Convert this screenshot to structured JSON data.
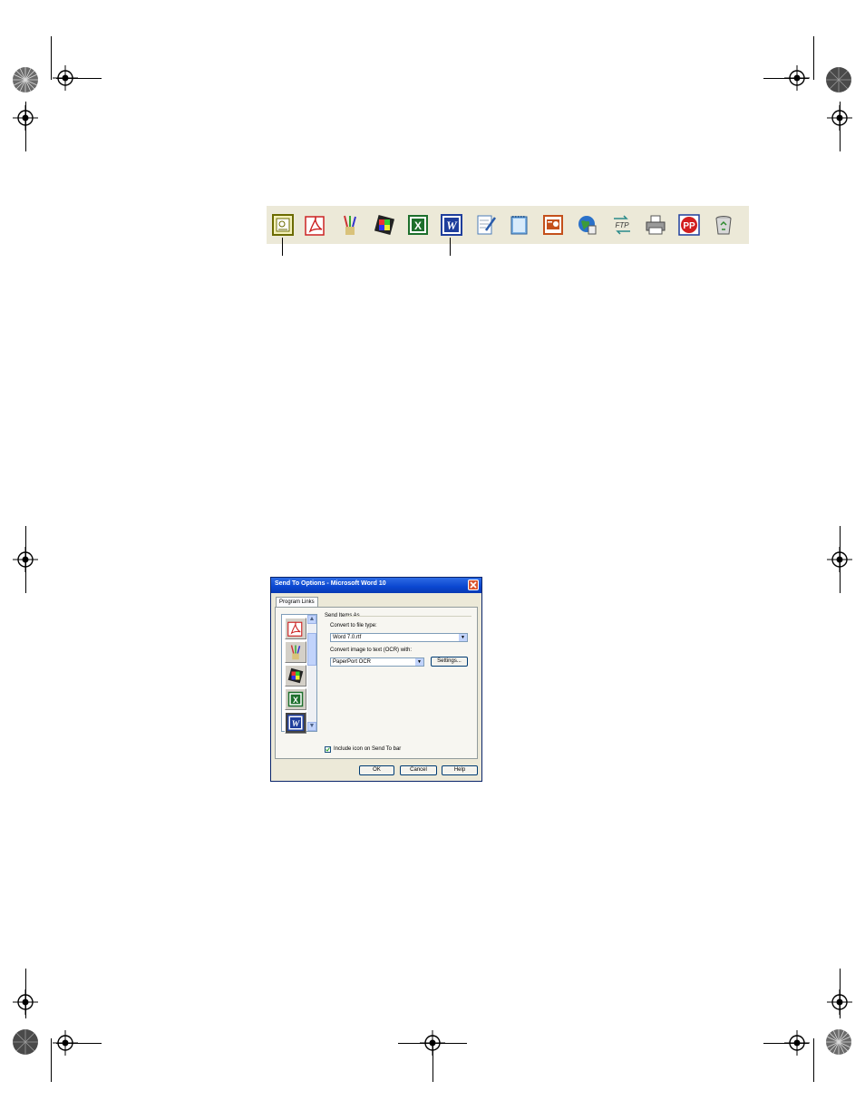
{
  "toolbar": {
    "icons": [
      "paperport-icon",
      "acrobat-pdf-icon",
      "paint-brushes-icon",
      "photo-editor-icon",
      "excel-icon",
      "word-icon",
      "wordpad-icon",
      "notepad-icon",
      "powerpoint-icon",
      "web-globe-icon",
      "ftp-icon",
      "printer-icon",
      "pagemanager-icon",
      "recycle-bin-icon"
    ]
  },
  "dialog": {
    "title": "Send To Options - Microsoft Word 10",
    "tab_label": "Program Links",
    "group_label": "Send Items As",
    "convert_label": "Convert to file type:",
    "convert_value": "Word 7.0.rtf",
    "ocr_label": "Convert image to text (OCR) with:",
    "ocr_value": "PaperPort OCR",
    "settings_button": "Settings...",
    "include_label": "Include icon on Send To bar",
    "include_checked": true,
    "ok_button": "OK",
    "cancel_button": "Cancel",
    "help_button": "Help",
    "list_icons": [
      "acrobat-pdf-icon",
      "paint-brushes-icon",
      "photo-editor-icon",
      "excel-icon",
      "word-icon"
    ]
  }
}
